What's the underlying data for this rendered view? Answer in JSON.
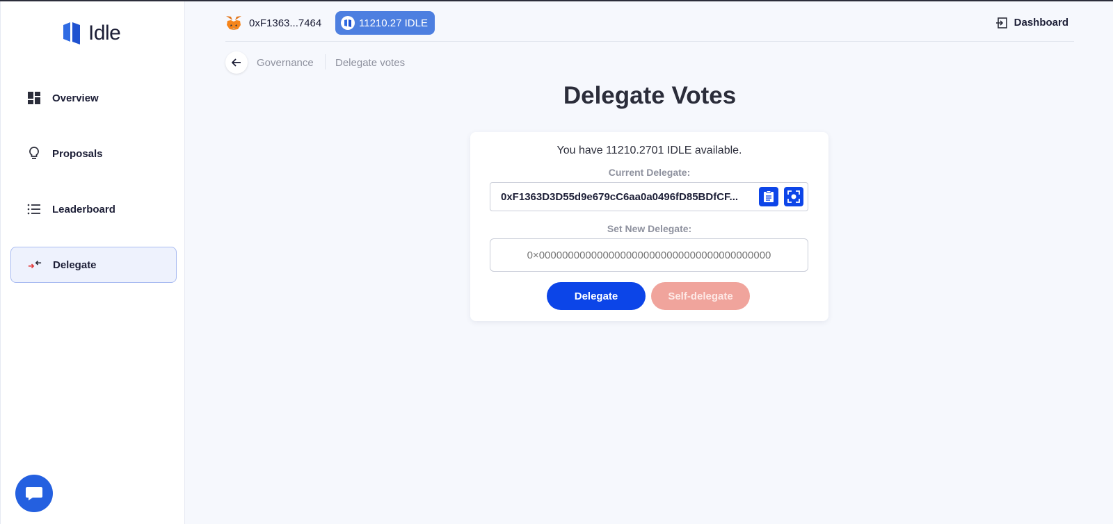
{
  "app": {
    "name": "Idle"
  },
  "sidebar": {
    "items": [
      {
        "label": "Overview",
        "icon": "dashboard-grid-icon"
      },
      {
        "label": "Proposals",
        "icon": "lightbulb-icon"
      },
      {
        "label": "Leaderboard",
        "icon": "list-icon"
      },
      {
        "label": "Delegate",
        "icon": "delegate-arrows-icon",
        "active": true
      }
    ]
  },
  "header": {
    "wallet_address": "0xF1363...7464",
    "balance": "11210.27 IDLE",
    "dashboard_label": "Dashboard"
  },
  "breadcrumb": {
    "parent": "Governance",
    "current": "Delegate votes"
  },
  "main": {
    "title": "Delegate Votes",
    "available_text": "You have 11210.2701 IDLE available.",
    "current_delegate_label": "Current Delegate:",
    "current_delegate_value": "0xF1363D3D55d9e679cC6aa0a0496fD85BDfCF...",
    "new_delegate_label": "Set New Delegate:",
    "new_delegate_placeholder": "0×0000000000000000000000000000000000000000",
    "delegate_button": "Delegate",
    "self_delegate_button": "Self-delegate"
  },
  "colors": {
    "primary": "#0c45e8",
    "disabled_button": "#f0a49c",
    "balance_chip": "#4d7fe0",
    "background": "#f6f8fd"
  }
}
